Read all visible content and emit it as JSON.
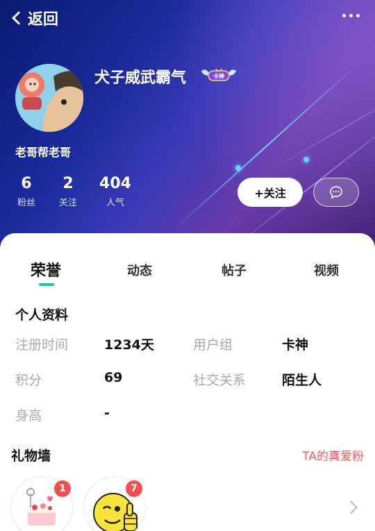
{
  "header": {
    "back_label": "返回"
  },
  "profile": {
    "username": "犬子威武霸气",
    "badge_text": "卡神",
    "guild": "老哥帮老哥"
  },
  "stats": [
    {
      "value": "6",
      "label": "粉丝"
    },
    {
      "value": "2",
      "label": "关注"
    },
    {
      "value": "404",
      "label": "人气"
    }
  ],
  "actions": {
    "follow_label": "+关注"
  },
  "tabs": [
    {
      "label": "荣誉",
      "active": true
    },
    {
      "label": "动态",
      "active": false
    },
    {
      "label": "帖子",
      "active": false
    },
    {
      "label": "视频",
      "active": false
    }
  ],
  "personal_info": {
    "title": "个人资料",
    "rows": [
      {
        "key": "注册时间",
        "value": "1234天"
      },
      {
        "key": "用户组",
        "value": "卡神"
      },
      {
        "key": "积分",
        "value": "69"
      },
      {
        "key": "社交关系",
        "value": "陌生人"
      },
      {
        "key": "身高",
        "value": "-"
      }
    ]
  },
  "gift_wall": {
    "title": "礼物墙",
    "link": "TA的真爱粉",
    "gifts": [
      {
        "icon": "cake-gift-icon",
        "count": "1"
      },
      {
        "icon": "thumbs-up-emoji-icon",
        "count": "7"
      }
    ]
  },
  "colors": {
    "accent": "#1fc5a8",
    "link_red": "#f25c5c",
    "badge_red": "#f04f4f"
  }
}
